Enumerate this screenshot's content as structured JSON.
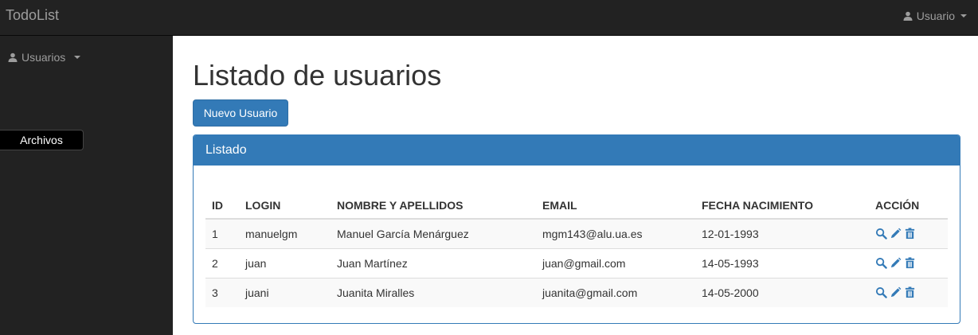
{
  "navbar": {
    "brand": "TodoList",
    "user_label": "Usuario"
  },
  "sidebar": {
    "users_label": "Usuarios",
    "tooltip": "Archivos"
  },
  "main": {
    "title": "Listado de usuarios",
    "new_button": "Nuevo Usuario",
    "panel_title": "Listado"
  },
  "table": {
    "headers": [
      "ID",
      "LOGIN",
      "NOMBRE Y APELLIDOS",
      "EMAIL",
      "FECHA NACIMIENTO",
      "ACCIÓN"
    ],
    "rows": [
      [
        "1",
        "manuelgm",
        "Manuel García Menárguez",
        "mgm143@alu.ua.es",
        "12-01-1993"
      ],
      [
        "2",
        "juan",
        "Juan Martínez",
        "juan@gmail.com",
        "14-05-1993"
      ],
      [
        "3",
        "juani",
        "Juanita Miralles",
        "juanita@gmail.com",
        "14-05-2000"
      ]
    ]
  },
  "icons": {
    "user": "user-icon",
    "view": "search-icon",
    "edit": "pencil-icon",
    "delete": "trash-icon"
  },
  "colors": {
    "primary": "#337ab7",
    "navbar_bg": "#222222",
    "navbar_text": "#9d9d9d"
  }
}
